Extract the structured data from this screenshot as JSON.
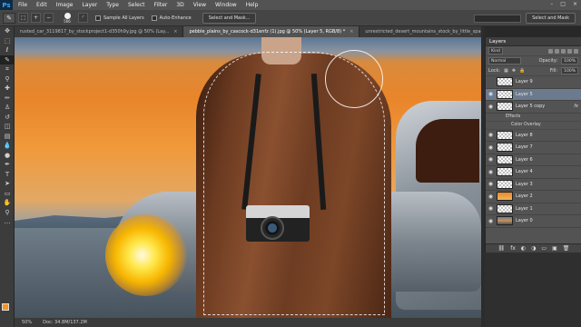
{
  "app": {
    "logo": "Ps"
  },
  "menu": [
    "File",
    "Edit",
    "Image",
    "Layer",
    "Type",
    "Select",
    "Filter",
    "3D",
    "View",
    "Window",
    "Help"
  ],
  "window_controls": [
    "–",
    "□",
    "×"
  ],
  "options": {
    "brush_size": "566",
    "sample_all_layers": "Sample All Layers",
    "auto_enhance": "Auto-Enhance",
    "select_and_mask": "Select and Mask...",
    "right_field": "",
    "right_button": "Select and Mask"
  },
  "tabs": [
    {
      "label": "rusted_car_3119817_by_stockproject1-d350h9y.jpg @ 50% (Lay...",
      "active": false
    },
    {
      "label": "pebble_plains_by_cascock-d31enfz (1).jpg @ 50% (Layer 5, RGB/8) *",
      "active": true
    },
    {
      "label": "unrestricted_desert_mountains_stock_by_little_spacey-d9wo",
      "active": false
    }
  ],
  "status": {
    "zoom": "50%",
    "doc": "Doc: 34.8M/137.2M"
  },
  "layers_panel": {
    "title": "Layers",
    "kind_label": "Kind",
    "blend_mode": "Normal",
    "opacity_label": "Opacity:",
    "opacity_value": "100%",
    "lock_label": "Lock:",
    "fill_label": "Fill:",
    "fill_value": "100%",
    "layers": [
      {
        "name": "Layer 9",
        "thumb": "transparent",
        "visible": false,
        "selected": false,
        "fx": false
      },
      {
        "name": "Layer 5",
        "thumb": "transparent",
        "visible": true,
        "selected": true,
        "fx": false
      },
      {
        "name": "Layer 5 copy",
        "thumb": "transparent",
        "visible": true,
        "selected": false,
        "fx": true
      },
      {
        "name": "Layer 8",
        "thumb": "transparent",
        "visible": true,
        "selected": false,
        "fx": false
      },
      {
        "name": "Layer 7",
        "thumb": "transparent",
        "visible": true,
        "selected": false,
        "fx": false
      },
      {
        "name": "Layer 6",
        "thumb": "transparent",
        "visible": true,
        "selected": false,
        "fx": false
      },
      {
        "name": "Layer 4",
        "thumb": "transparent",
        "visible": true,
        "selected": false,
        "fx": false
      },
      {
        "name": "Layer 3",
        "thumb": "transparent",
        "visible": true,
        "selected": false,
        "fx": false
      },
      {
        "name": "Layer 2",
        "thumb": "orange",
        "visible": true,
        "selected": false,
        "fx": false
      },
      {
        "name": "Layer 1",
        "thumb": "transparent",
        "visible": true,
        "selected": false,
        "fx": false
      },
      {
        "name": "Layer 0",
        "thumb": "photo",
        "visible": true,
        "selected": false,
        "fx": false
      }
    ],
    "effects_label": "Effects",
    "effect_item": "Color Overlay",
    "footer_icons": [
      "⛓",
      "fx",
      "◐",
      "◑",
      "▭",
      "▣",
      "🗑"
    ]
  },
  "colors": {
    "foreground": "#f7931e",
    "background": "#ffffff",
    "accent": "#6b7a8c"
  }
}
